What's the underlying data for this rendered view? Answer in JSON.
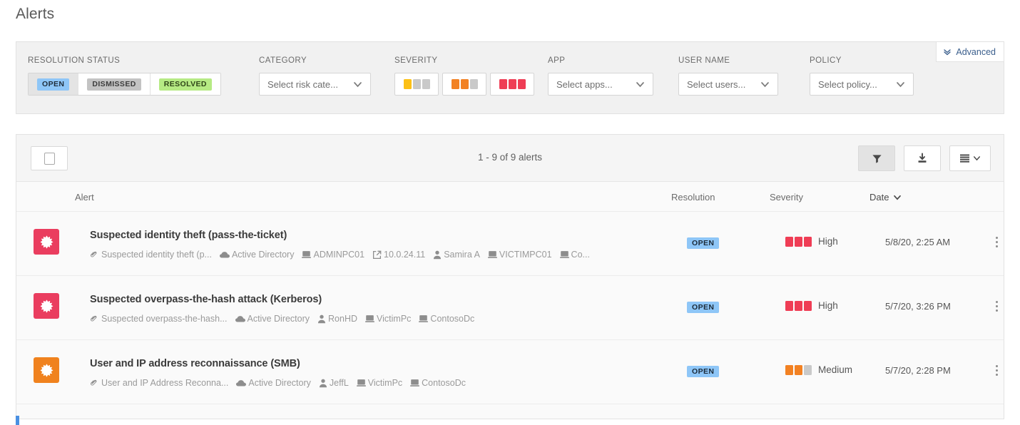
{
  "page": {
    "title": "Alerts"
  },
  "filters": {
    "advanced": {
      "label": "Advanced",
      "icon": "double-chevron-down-icon"
    },
    "resolution_status": {
      "label": "RESOLUTION STATUS",
      "options": [
        {
          "label": "OPEN",
          "selected": true
        },
        {
          "label": "DISMISSED",
          "selected": false
        },
        {
          "label": "RESOLVED",
          "selected": false
        }
      ]
    },
    "category": {
      "label": "CATEGORY",
      "value": "Select risk cate...",
      "icon": "chevron-down-icon"
    },
    "severity": {
      "label": "SEVERITY",
      "options": [
        {
          "name": "low",
          "bars": [
            "y",
            "g",
            "g"
          ]
        },
        {
          "name": "medium",
          "bars": [
            "o",
            "o",
            "g"
          ]
        },
        {
          "name": "high",
          "bars": [
            "r",
            "r",
            "r"
          ]
        }
      ]
    },
    "app": {
      "label": "APP",
      "value": "Select apps...",
      "icon": "chevron-down-icon"
    },
    "user_name": {
      "label": "USER NAME",
      "value": "Select users...",
      "icon": "chevron-down-icon"
    },
    "policy": {
      "label": "POLICY",
      "value": "Select policy...",
      "icon": "chevron-down-icon"
    }
  },
  "toolbar": {
    "select_all": "select-all-checkbox",
    "count": "1 - 9 of 9 alerts",
    "filter_button": "filter-icon",
    "export_button": "download-icon",
    "view_button": "list-view-icon"
  },
  "table": {
    "columns": {
      "alert": "Alert",
      "resolution": "Resolution",
      "severity": "Severity",
      "date": "Date",
      "date_sort_icon": "chevron-down-icon"
    },
    "rows": [
      {
        "icon_color": "#ea3d5f",
        "title": "Suspected identity theft (pass-the-ticket)",
        "meta": [
          {
            "icon": "policy-icon",
            "text": "Suspected identity theft (p..."
          },
          {
            "icon": "cloud-icon",
            "text": "Active Directory"
          },
          {
            "icon": "computer-icon",
            "text": "ADMINPC01"
          },
          {
            "icon": "external-link-icon",
            "text": "10.0.24.11"
          },
          {
            "icon": "user-icon",
            "text": "Samira A"
          },
          {
            "icon": "computer-icon",
            "text": "VICTIMPC01"
          },
          {
            "icon": "computer-icon",
            "text": "Co..."
          }
        ],
        "resolution": "OPEN",
        "severity": {
          "label": "High",
          "bars": [
            "r",
            "r",
            "r"
          ]
        },
        "date": "5/8/20, 2:25 AM"
      },
      {
        "icon_color": "#ea3d5f",
        "title": "Suspected overpass-the-hash attack (Kerberos)",
        "meta": [
          {
            "icon": "policy-icon",
            "text": "Suspected overpass-the-hash..."
          },
          {
            "icon": "cloud-icon",
            "text": "Active Directory"
          },
          {
            "icon": "user-icon",
            "text": "RonHD"
          },
          {
            "icon": "computer-icon",
            "text": "VictimPc"
          },
          {
            "icon": "computer-icon",
            "text": "ContosoDc"
          }
        ],
        "resolution": "OPEN",
        "severity": {
          "label": "High",
          "bars": [
            "r",
            "r",
            "r"
          ]
        },
        "date": "5/7/20, 3:26 PM"
      },
      {
        "icon_color": "#f0821e",
        "title": "User and IP address reconnaissance (SMB)",
        "meta": [
          {
            "icon": "policy-icon",
            "text": "User and IP Address Reconna..."
          },
          {
            "icon": "cloud-icon",
            "text": "Active Directory"
          },
          {
            "icon": "user-icon",
            "text": "JeffL"
          },
          {
            "icon": "computer-icon",
            "text": "VictimPc"
          },
          {
            "icon": "computer-icon",
            "text": "ContosoDc"
          }
        ],
        "resolution": "OPEN",
        "severity": {
          "label": "Medium",
          "bars": [
            "o",
            "o",
            "g"
          ]
        },
        "date": "5/7/20, 2:28 PM"
      }
    ]
  },
  "colors": {
    "severity_low": "#fcc016",
    "severity_medium": "#f28122",
    "severity_high": "#ef3d55",
    "severity_empty": "#c9c9c9",
    "badge_open": "#8ec6f7",
    "badge_dismissed": "#c3c3c3",
    "badge_resolved": "#b6ea84",
    "accent_link": "#3a5e8c"
  }
}
